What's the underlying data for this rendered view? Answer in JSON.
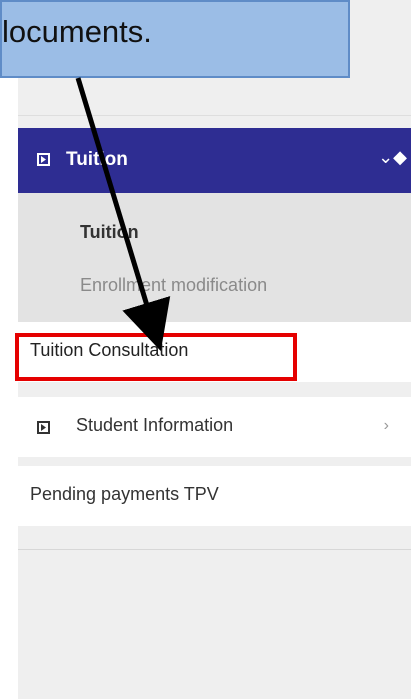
{
  "callout": {
    "text": "locuments."
  },
  "menu": {
    "section_header": "Tuition",
    "subitems": [
      "Tuition",
      "Enrollment modification"
    ],
    "items": [
      {
        "label": "Tuition Consultation"
      },
      {
        "label": "Student Information"
      },
      {
        "label": "Pending payments TPV"
      }
    ]
  },
  "colors": {
    "header": "#2e2d92",
    "highlight": "#e50000",
    "callout": "#9bbde6"
  },
  "icons": [
    "square-play-icon",
    "chevron-down-icon",
    "chevron-right-icon",
    "arrow-annotation-icon"
  ]
}
